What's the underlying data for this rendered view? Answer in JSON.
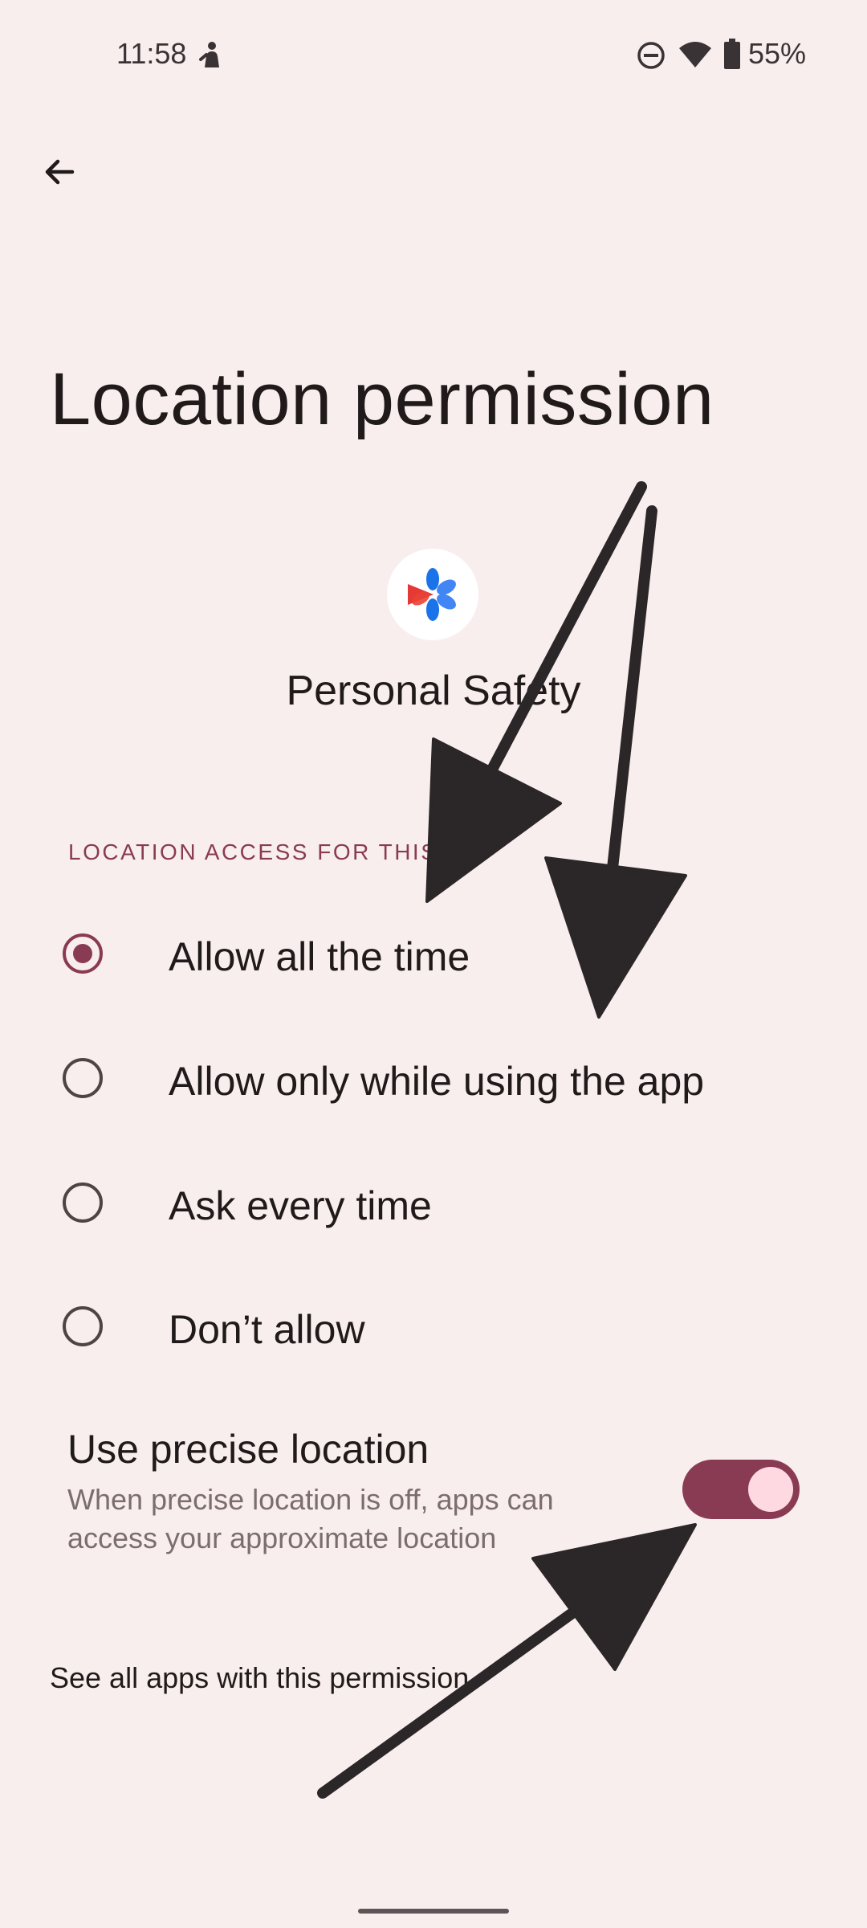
{
  "status_bar": {
    "time": "11:58",
    "battery_percent": "55%",
    "icons": [
      "person-icon",
      "do-not-disturb-icon",
      "wifi-icon",
      "battery-icon"
    ]
  },
  "header": {
    "back_icon": "arrow-back-icon",
    "title": "Location permission"
  },
  "app": {
    "icon": "personal-safety-app-icon",
    "name": "Personal Safety"
  },
  "section": {
    "header": "LOCATION ACCESS FOR THIS APP",
    "options": [
      {
        "label": "Allow all the time",
        "selected": true
      },
      {
        "label": "Allow only while using the app",
        "selected": false
      },
      {
        "label": "Ask every time",
        "selected": false
      },
      {
        "label": "Don’t allow",
        "selected": false
      }
    ]
  },
  "precise_location": {
    "title": "Use precise location",
    "summary": "When precise location is off, apps can access your approximate location",
    "enabled": true
  },
  "footer": {
    "see_all_link": "See all apps with this permission"
  },
  "colors": {
    "background": "#f9eeee",
    "accent": "#8a3b54",
    "toggle_knob": "#ffd9e2",
    "annotation_arrow": "#2b2627"
  }
}
